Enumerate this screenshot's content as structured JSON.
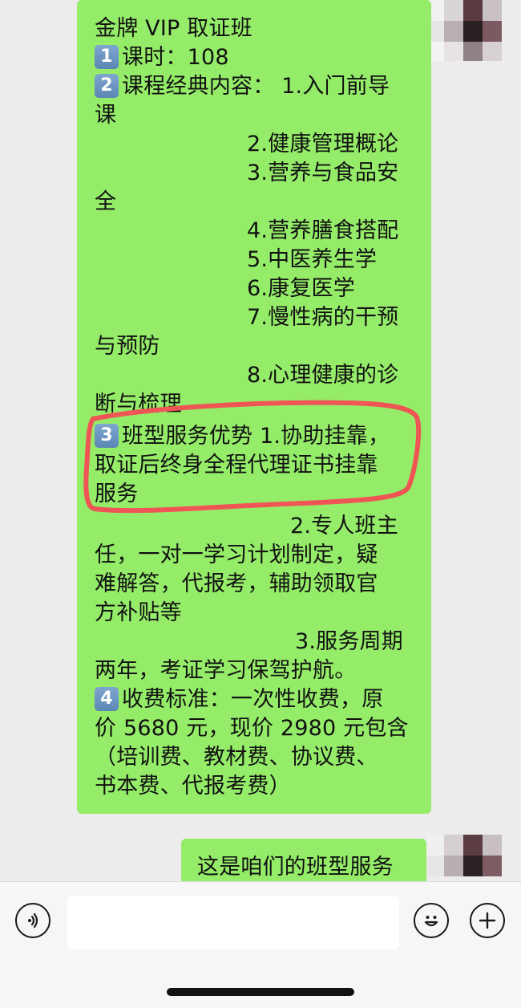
{
  "chat": {
    "message_lines": [
      "金牌 VIP 取证班",
      "课时：108",
      "课程经典内容：  1.入门前导",
      "课",
      "2.健康管理概论",
      "3.营养与食品安",
      "全",
      "4.营养膳食搭配",
      "5.中医养生学",
      "6.康复医学",
      "7.慢性病的干预",
      "与预防",
      "8.心理健康的诊",
      "断与梳理",
      "班型服务优势 1.协助挂靠，",
      "取证后终身全程代理证书挂靠",
      "服务",
      "2.专人班主",
      "任，一对一学习计划制定，疑",
      "难解答，代报考，辅助领取官",
      "方补贴等",
      "3.服务周期",
      "两年，考证学习保驾护航。",
      "收费标准：一次性收费，原",
      "价 5680 元，现价 2980 元包含",
      "（培训费、教材费、协议费、",
      "书本费、代报考费）"
    ],
    "keycaps": [
      "1",
      "2",
      "3",
      "4"
    ],
    "reply": "这是咱们的班型服务"
  },
  "colors": {
    "bubble": "#95ec69",
    "highlight": "#f05555",
    "background": "#ececec"
  },
  "input_bar": {
    "voice_icon": "voice-icon",
    "emoji_icon": "emoji-icon",
    "plus_icon": "plus-icon"
  }
}
